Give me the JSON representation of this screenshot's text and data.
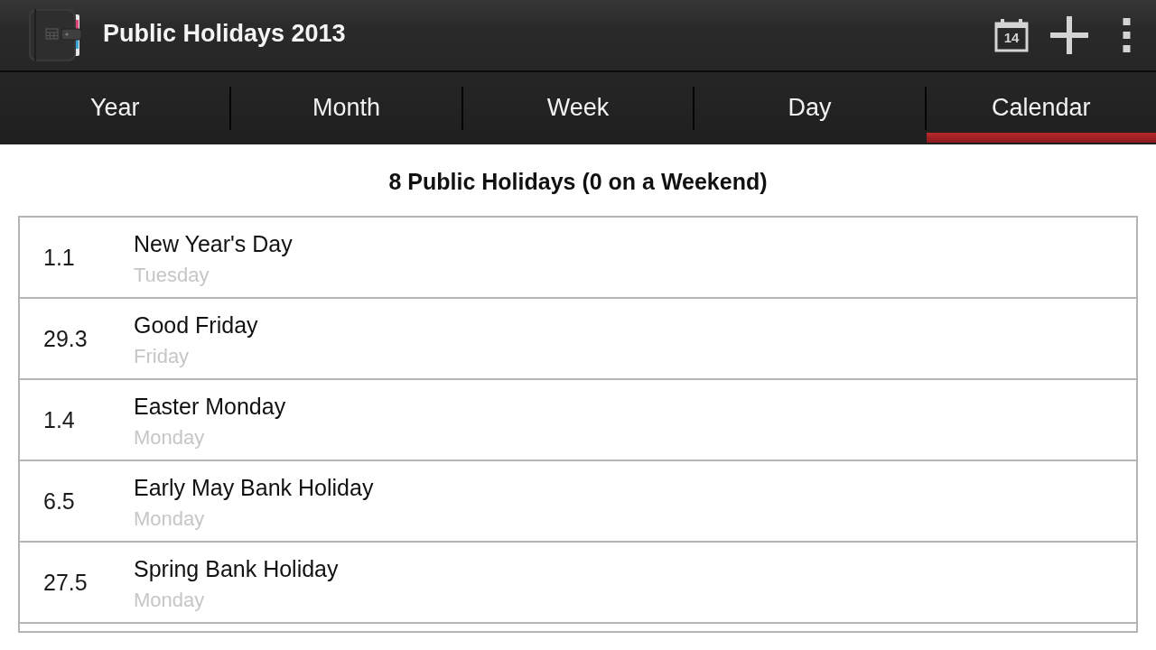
{
  "action_bar": {
    "title": "Public Holidays 2013",
    "actions": [
      {
        "kind": "calendar",
        "label": "14"
      },
      {
        "kind": "add"
      },
      {
        "kind": "overflow"
      }
    ]
  },
  "tabs": [
    {
      "label": "Year",
      "selected": false
    },
    {
      "label": "Month",
      "selected": false
    },
    {
      "label": "Week",
      "selected": false
    },
    {
      "label": "Day",
      "selected": false
    },
    {
      "label": "Calendar",
      "selected": true
    }
  ],
  "summary": "8 Public Holidays (0 on a Weekend)",
  "holidays": [
    {
      "date": "1.1",
      "name": "New Year's Day",
      "weekday": "Tuesday"
    },
    {
      "date": "29.3",
      "name": "Good Friday",
      "weekday": "Friday"
    },
    {
      "date": "1.4",
      "name": "Easter Monday",
      "weekday": "Monday"
    },
    {
      "date": "6.5",
      "name": "Early May Bank Holiday",
      "weekday": "Monday"
    },
    {
      "date": "27.5",
      "name": "Spring Bank Holiday",
      "weekday": "Monday"
    }
  ]
}
